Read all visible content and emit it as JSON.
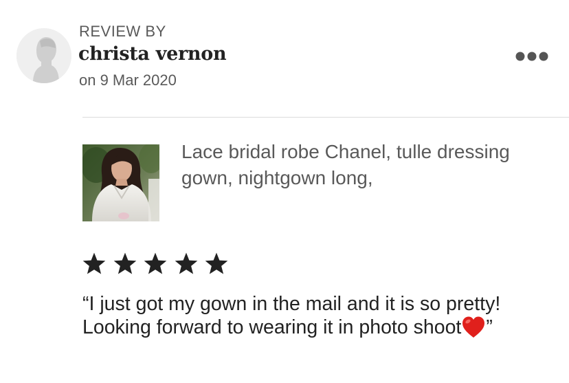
{
  "review": {
    "header_label": "REVIEW BY",
    "reviewer_name": "christa vernon",
    "date": "on 9 Mar 2020",
    "rating": 5,
    "rating_max": 5,
    "text_open": "“I just got my gown in the mail and it is so pretty! Looking forward to wearing it in photo shoot",
    "emoji": "❤️",
    "text_close": "”"
  },
  "product": {
    "title": "Lace bridal robe Chanel,  tulle dressing gown, nightgown long,"
  },
  "icons": {
    "avatar": "person-silhouette-icon",
    "more": "ellipsis-icon",
    "star": "star-icon",
    "heart": "red-heart-emoji"
  },
  "colors": {
    "star": "#222222",
    "secondary_text": "#595959",
    "avatar_bg": "#efefef",
    "divider": "#dcdcdc",
    "heart": "#e0201c"
  }
}
